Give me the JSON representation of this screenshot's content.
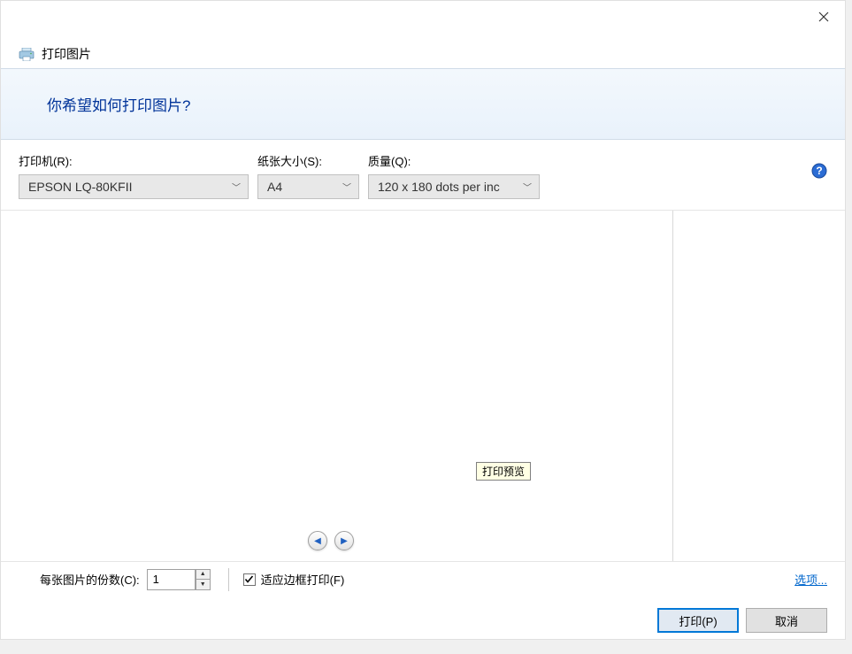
{
  "title": "打印图片",
  "header_question": "你希望如何打印图片?",
  "printer": {
    "label": "打印机(R):",
    "value": "EPSON LQ-80KFII"
  },
  "paper": {
    "label": "纸张大小(S):",
    "value": "A4"
  },
  "quality": {
    "label": "质量(Q):",
    "value": "120 x 180 dots per inc"
  },
  "tooltip": "打印预览",
  "copies": {
    "label": "每张图片的份数(C):",
    "value": "1"
  },
  "fit_frame": {
    "checked": true,
    "label": "适应边框打印(F)"
  },
  "options_link": "选项...",
  "buttons": {
    "print": "打印(P)",
    "cancel": "取消"
  }
}
